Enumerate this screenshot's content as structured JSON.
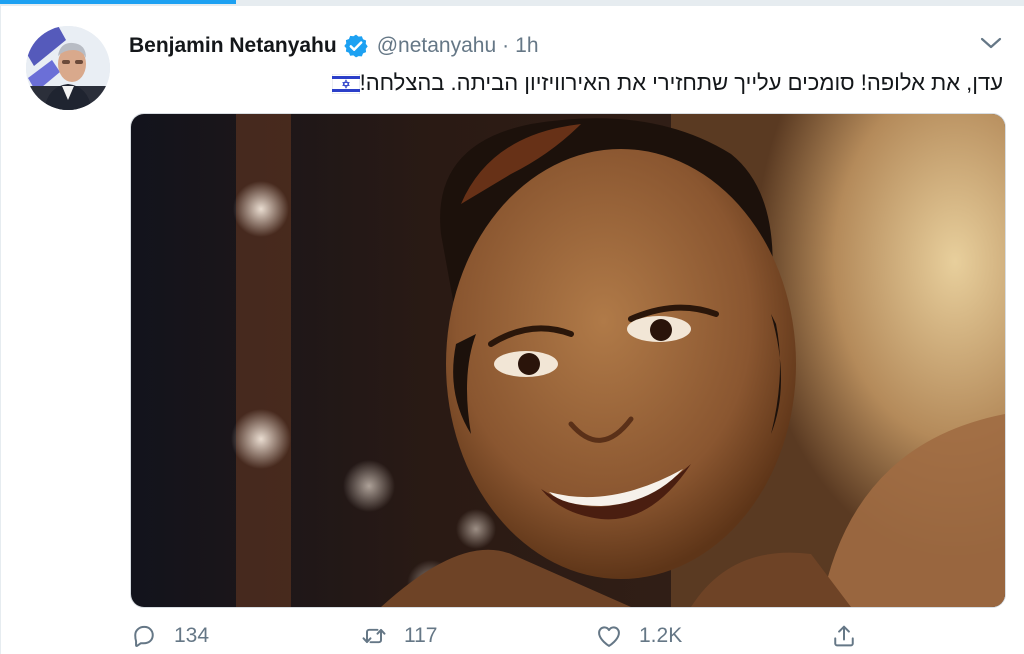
{
  "tweet": {
    "author_name": "Benjamin Netanyahu",
    "handle": "@netanyahu",
    "separator": "·",
    "time": "1h",
    "text": "עדן, את אלופה! סומכים עלייך שתחזירי את האירוויזיון הביתה. בהצלחה!",
    "verified": true
  },
  "actions": {
    "reply_count": "134",
    "retweet_count": "117",
    "like_count": "1.2K"
  },
  "icons": [
    "verified-badge-icon",
    "chevron-down-icon",
    "israel-flag-emoji",
    "reply-icon",
    "retweet-icon",
    "like-icon",
    "share-icon"
  ],
  "colors": {
    "accent": "#1da1f2",
    "text_primary": "#14171a",
    "text_secondary": "#657786",
    "border": "#e6ecf0"
  }
}
